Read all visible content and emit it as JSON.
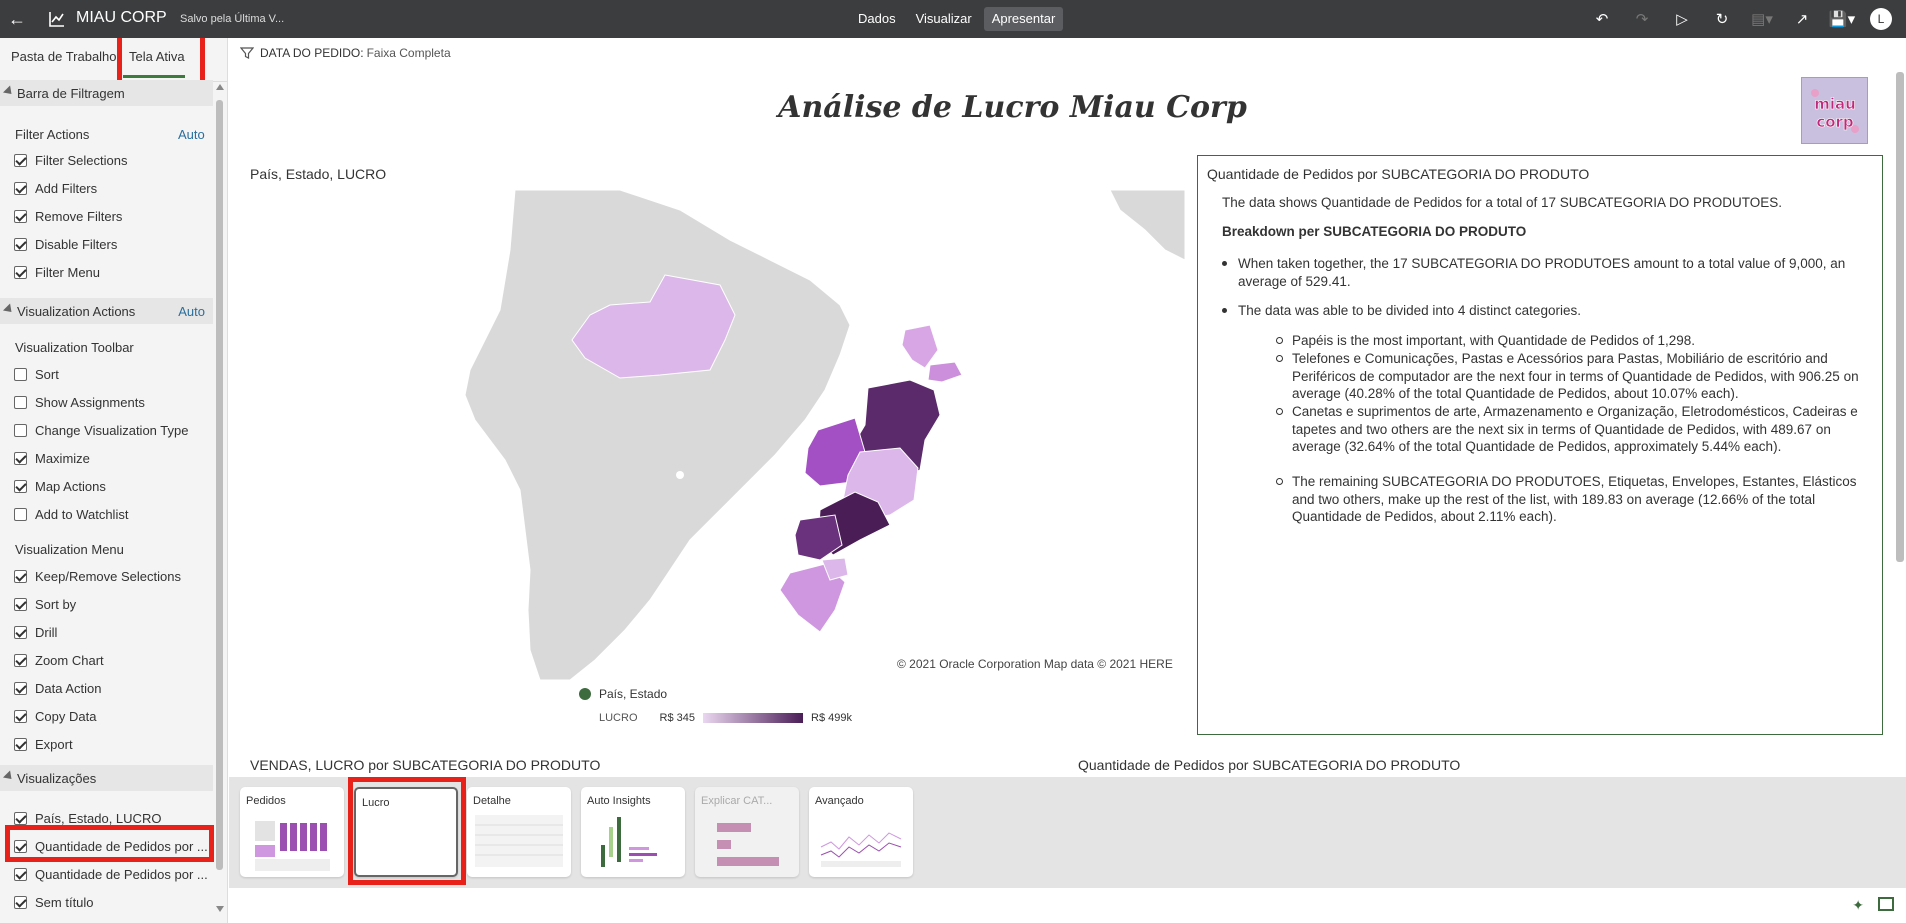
{
  "header": {
    "back_icon": "arrow-left-icon",
    "app_title": "MIAU CORP",
    "saved_status": "Salvo pela Última V...",
    "modes": [
      "Dados",
      "Visualizar",
      "Apresentar"
    ],
    "active_mode": "Apresentar",
    "user_initial": "L"
  },
  "panel": {
    "tabs": [
      "Pasta de Trabalho",
      "Tela Ativa"
    ],
    "active_tab": "Tela Ativa",
    "sections": {
      "filterbar": "Barra de Filtragem",
      "viz_actions": "Visualization Actions",
      "visualizations": "Visualizações"
    },
    "auto_label": "Auto",
    "filter_actions_title": "Filter Actions",
    "filter_actions": [
      {
        "label": "Filter Selections",
        "checked": true
      },
      {
        "label": "Add Filters",
        "checked": true
      },
      {
        "label": "Remove Filters",
        "checked": true
      },
      {
        "label": "Disable Filters",
        "checked": true
      },
      {
        "label": "Filter Menu",
        "checked": true
      }
    ],
    "viz_toolbar_title": "Visualization Toolbar",
    "viz_toolbar": [
      {
        "label": "Sort",
        "checked": false
      },
      {
        "label": "Show Assignments",
        "checked": false
      },
      {
        "label": "Change Visualization Type",
        "checked": false
      },
      {
        "label": "Maximize",
        "checked": true
      },
      {
        "label": "Map Actions",
        "checked": true
      },
      {
        "label": "Add to Watchlist",
        "checked": false
      }
    ],
    "viz_menu_title": "Visualization Menu",
    "viz_menu": [
      {
        "label": "Keep/Remove Selections",
        "checked": true
      },
      {
        "label": "Sort by",
        "checked": true
      },
      {
        "label": "Drill",
        "checked": true
      },
      {
        "label": "Zoom Chart",
        "checked": true
      },
      {
        "label": "Data Action",
        "checked": true
      },
      {
        "label": "Copy Data",
        "checked": true
      },
      {
        "label": "Export",
        "checked": true
      }
    ],
    "visualizations": [
      {
        "label": "País, Estado, LUCRO",
        "checked": true
      },
      {
        "label": "Quantidade de Pedidos por ...",
        "checked": true
      },
      {
        "label": "Quantidade de Pedidos por ...",
        "checked": true
      },
      {
        "label": "Sem título",
        "checked": true
      }
    ]
  },
  "filter": {
    "label": "DATA DO PEDIDO:",
    "value": "Faixa Completa"
  },
  "canvas": {
    "title": "Análise de Lucro Miau Corp",
    "logo_text": "miau corp"
  },
  "map": {
    "title": "País, Estado, LUCRO",
    "copyright": "© 2021 Oracle Corporation   Map data © 2021 HERE",
    "legend_series": "País, Estado",
    "legend_measure": "LUCRO",
    "legend_min": "R$ 345",
    "legend_max": "R$ 499k",
    "colors": {
      "low": "#ead7f0",
      "high": "#4a1d57",
      "land": "#d9d9d9"
    }
  },
  "insight": {
    "title": "Quantidade de Pedidos por SUBCATEGORIA DO PRODUTO",
    "summary": "The data shows Quantidade de Pedidos for a total of 17 SUBCATEGORIA DO PRODUTOES.",
    "breakdown_head": "Breakdown per SUBCATEGORIA DO PRODUTO",
    "bullet1": "When taken together, the 17 SUBCATEGORIA DO PRODUTOES amount to a total value of 9,000, an average of 529.41.",
    "bullet2": "The data was able to be divided into 4 distinct categories.",
    "sub1": "Papéis is the most important, with Quantidade de Pedidos of 1,298.",
    "sub2": "Telefones e Comunicações, Pastas e Acessórios para Pastas, Mobiliário de escritório and Periféricos de computador are the next four in terms of Quantidade de Pedidos, with 906.25 on average (40.28% of the total Quantidade de Pedidos, about 10.07% each).",
    "sub3": "Canetas e suprimentos de arte, Armazenamento e Organização, Eletrodomésticos, Cadeiras e tapetes and two others are the next six in terms of Quantidade de Pedidos, with 489.67 on average (32.64% of the total Quantidade de Pedidos, approximately 5.44% each).",
    "sub4": "The remaining SUBCATEGORIA DO PRODUTOES, Etiquetas, Envelopes, Estantes, Elásticos and two others, make up the rest of the list, with 189.83 on average (12.66% of the total Quantidade de Pedidos, about 2.11% each)."
  },
  "bottom": {
    "title1": "VENDAS, LUCRO por SUBCATEGORIA DO PRODUTO",
    "title2": "Quantidade de Pedidos por SUBCATEGORIA DO PRODUTO"
  },
  "canvases": [
    {
      "label": "Pedidos"
    },
    {
      "label": "Lucro"
    },
    {
      "label": "Detalhe"
    },
    {
      "label": "Auto Insights"
    },
    {
      "label": "Explicar CAT..."
    },
    {
      "label": "Avançado"
    }
  ]
}
